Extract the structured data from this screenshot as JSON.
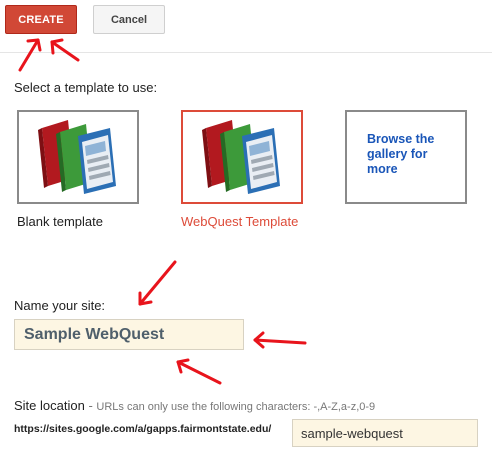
{
  "toolbar": {
    "create_label": "CREATE",
    "cancel_label": "Cancel"
  },
  "templates": {
    "heading": "Select a template to use:",
    "items": [
      {
        "caption": "Blank template",
        "icon": "template-stack-icon",
        "selected": false
      },
      {
        "caption": "WebQuest Template",
        "icon": "template-stack-icon",
        "selected": true
      },
      {
        "caption": "",
        "link_text": "Browse the gallery for more"
      }
    ]
  },
  "site_name": {
    "label": "Name your site:",
    "value": "Sample WebQuest"
  },
  "site_location": {
    "label": "Site location",
    "separator": " - ",
    "hint": "URLs can only use the following characters: -,A-Z,a-z,0-9",
    "prefix": "https://sites.google.com/a/gapps.fairmontstate.edu/",
    "value": "sample-webquest"
  },
  "colors": {
    "primary_button": "#d14836",
    "selected_accent": "#dd4b39",
    "link": "#1a56b8",
    "input_background": "#fdf6e3",
    "annotation_arrow": "#e8141c"
  }
}
